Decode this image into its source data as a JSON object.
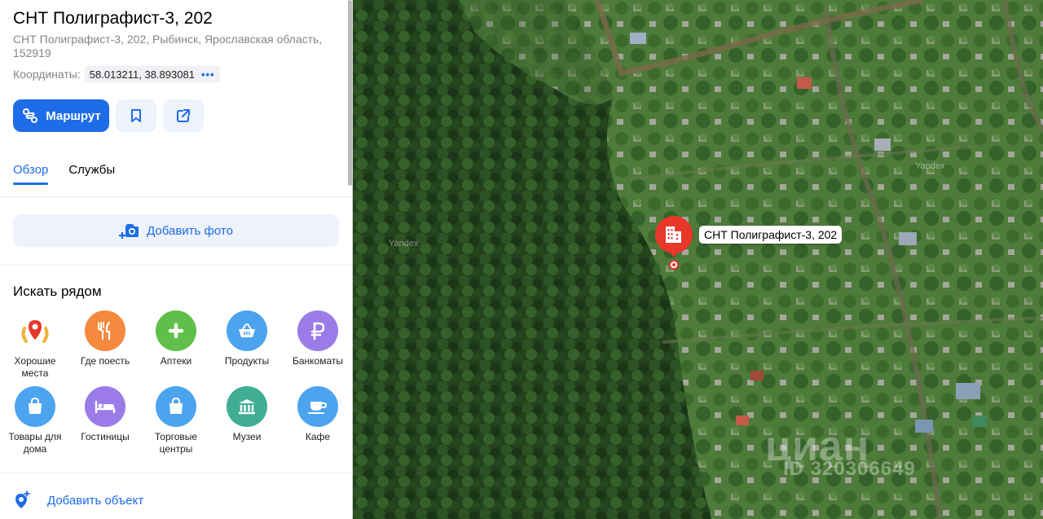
{
  "place": {
    "title": "СНТ Полиграфист-3, 202",
    "address": "СНТ Полиграфист-3, 202, Рыбинск, Ярославская область, 152919",
    "coords_label": "Координаты:",
    "coords_value": "58.013211, 38.893081",
    "coords_more": "•••"
  },
  "actions": {
    "route_label": "Маршрут",
    "bookmark_icon": "bookmark-icon",
    "share_icon": "share-icon"
  },
  "tabs": [
    {
      "label": "Обзор",
      "active": true
    },
    {
      "label": "Службы",
      "active": false
    }
  ],
  "add_photo_label": "Добавить фото",
  "nearby": {
    "title": "Искать рядом",
    "items": [
      {
        "label": "Хорошие места",
        "icon": "good-places-icon",
        "color": "#ffffff"
      },
      {
        "label": "Где поесть",
        "icon": "fork-knife-icon",
        "color": "#f5893d"
      },
      {
        "label": "Аптеки",
        "icon": "pharmacy-cross-icon",
        "color": "#5fbf4a"
      },
      {
        "label": "Продукты",
        "icon": "basket-icon",
        "color": "#4ca4ef"
      },
      {
        "label": "Банкоматы",
        "icon": "ruble-icon",
        "color": "#9b7be8"
      },
      {
        "label": "Товары для дома",
        "icon": "shopping-bag-icon",
        "color": "#4ca4ef"
      },
      {
        "label": "Гостиницы",
        "icon": "bed-icon",
        "color": "#9b7be8"
      },
      {
        "label": "Торговые центры",
        "icon": "shopping-bag-icon",
        "color": "#4ca4ef"
      },
      {
        "label": "Музеи",
        "icon": "museum-icon",
        "color": "#3fae95"
      },
      {
        "label": "Кафе",
        "icon": "cup-icon",
        "color": "#4ca4ef"
      }
    ]
  },
  "add_object_label": "Добавить объект",
  "map": {
    "pin_label": "СНТ Полиграфист-3, 202",
    "watermark": "Yandex",
    "cian_logo": "циан",
    "cian_id": "ID 320306649"
  },
  "colors": {
    "accent": "#1e6ce8",
    "pin": "#e8372b"
  }
}
